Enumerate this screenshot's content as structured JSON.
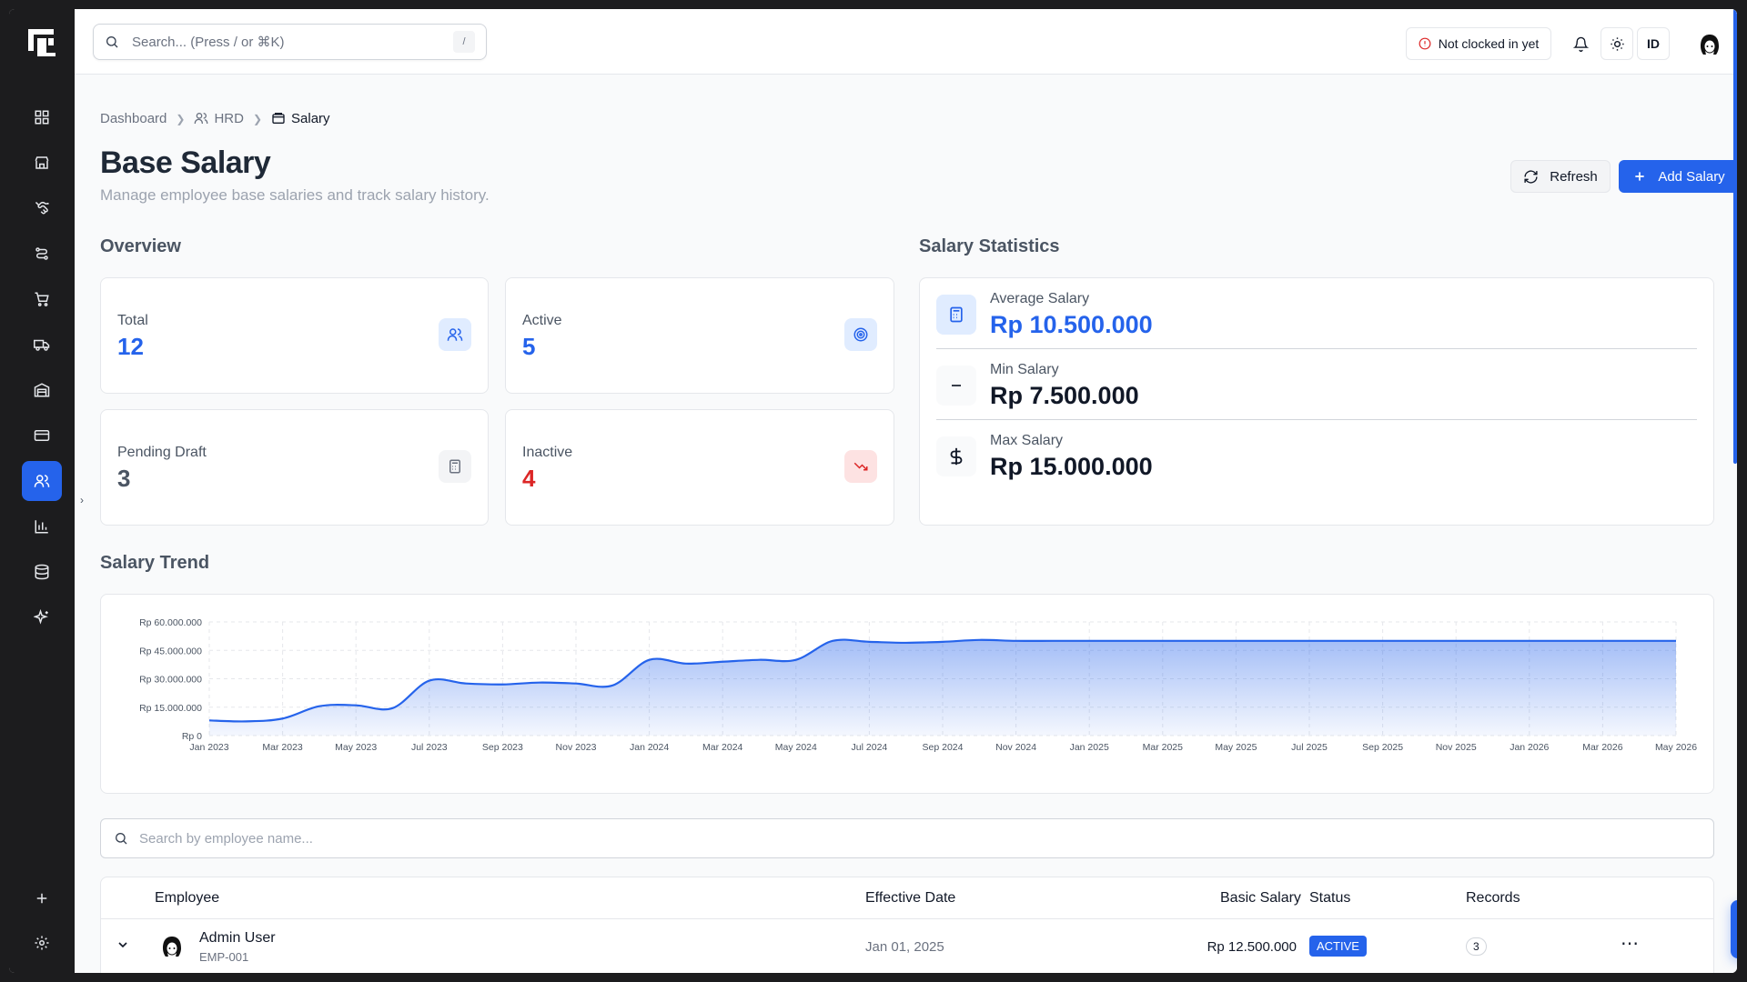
{
  "search": {
    "placeholder": "Search... (Press / or ⌘K)",
    "shortcut": "/"
  },
  "topbar": {
    "clock_status": "Not clocked in yet",
    "language": "ID"
  },
  "breadcrumb": [
    "Dashboard",
    "HRD",
    "Salary"
  ],
  "page": {
    "title": "Base Salary",
    "subtitle": "Manage employee base salaries and track salary history.",
    "refresh_label": "Refresh",
    "add_label": "Add Salary"
  },
  "overview": {
    "heading": "Overview",
    "cards": [
      {
        "label": "Total",
        "value": "12",
        "color": "#2563eb",
        "icon": "users-icon"
      },
      {
        "label": "Active",
        "value": "5",
        "color": "#2563eb",
        "icon": "target-icon"
      },
      {
        "label": "Pending Draft",
        "value": "3",
        "color": "#4b5563",
        "icon": "calculator-icon"
      },
      {
        "label": "Inactive",
        "value": "4",
        "color": "#dc2626",
        "icon": "trending-down-icon"
      }
    ]
  },
  "salary_stats": {
    "heading": "Salary Statistics",
    "rows": [
      {
        "label": "Average Salary",
        "value": "Rp 10.500.000",
        "color": "#2563eb",
        "icon": "calculator-icon"
      },
      {
        "label": "Min Salary",
        "value": "Rp 7.500.000",
        "color": "#111827",
        "icon": "minus-icon"
      },
      {
        "label": "Max Salary",
        "value": "Rp 15.000.000",
        "color": "#111827",
        "icon": "dollar-icon"
      }
    ]
  },
  "trend": {
    "heading": "Salary Trend"
  },
  "chart_data": {
    "type": "area",
    "title": "",
    "xlabel": "",
    "ylabel": "",
    "x_ticks": [
      "Jan 2023",
      "Mar 2023",
      "May 2023",
      "Jul 2023",
      "Sep 2023",
      "Nov 2023",
      "Jan 2024",
      "Mar 2024",
      "May 2024",
      "Jul 2024",
      "Sep 2024",
      "Nov 2024",
      "Jan 2025",
      "Mar 2025",
      "May 2025",
      "Jul 2025",
      "Sep 2025",
      "Nov 2025",
      "Jan 2026",
      "Mar 2026",
      "May 2026"
    ],
    "y_ticks": [
      "Rp 0",
      "Rp 15.000.000",
      "Rp 30.000.000",
      "Rp 45.000.000",
      "Rp 60.000.000"
    ],
    "ylim": [
      0,
      60000000
    ],
    "grid": true,
    "color": "#2563eb",
    "series": [
      {
        "values": [
          8000000,
          7500000,
          9000000,
          15500000,
          16000000,
          14500000,
          29000000,
          27500000,
          27000000,
          28000000,
          27500000,
          26500000,
          40000000,
          38000000,
          39000000,
          40000000,
          40000000,
          50000000,
          49500000,
          49000000,
          49500000,
          50500000,
          50000000,
          50000000,
          50000000,
          50000000,
          50000000,
          50000000,
          50000000,
          50000000,
          50000000,
          50000000,
          50000000,
          50000000,
          50000000,
          50000000,
          50000000,
          50000000,
          50000000,
          50000000,
          50000000
        ]
      }
    ]
  },
  "table": {
    "search_placeholder": "Search by employee name...",
    "headers": {
      "employee": "Employee",
      "effective_date": "Effective Date",
      "basic_salary": "Basic Salary",
      "status": "Status",
      "records": "Records"
    },
    "rows": [
      {
        "name": "Admin User",
        "code": "EMP-001",
        "effective_date": "Jan 01, 2025",
        "basic_salary": "Rp 12.500.000",
        "status": "ACTIVE",
        "records": "3"
      }
    ]
  }
}
